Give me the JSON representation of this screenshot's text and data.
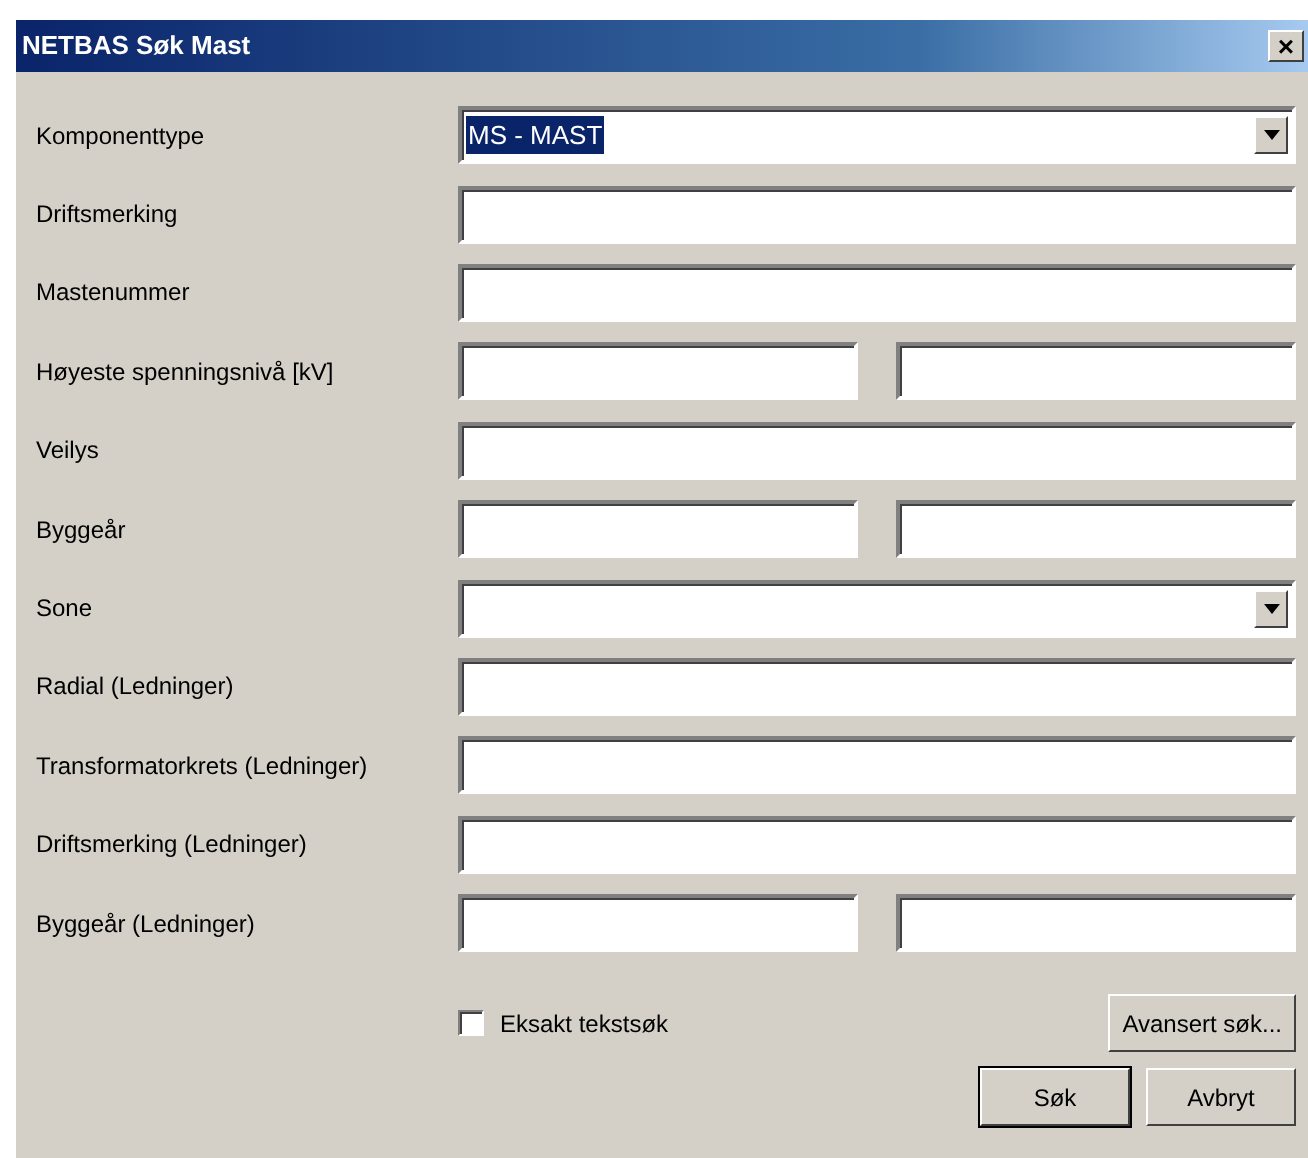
{
  "window": {
    "title": "NETBAS Søk Mast",
    "close": "×"
  },
  "fields": [
    {
      "label": "Komponenttype",
      "kind": "combo",
      "value": "MS - MAST",
      "selected": true
    },
    {
      "label": "Driftsmerking",
      "kind": "text"
    },
    {
      "label": "Mastenummer",
      "kind": "text"
    },
    {
      "label": "Høyeste spenningsnivå [kV]",
      "kind": "range"
    },
    {
      "label": "Veilys",
      "kind": "text"
    },
    {
      "label": "Byggeår",
      "kind": "range"
    },
    {
      "label": "Sone",
      "kind": "combo"
    },
    {
      "label": "Radial (Ledninger)",
      "kind": "text"
    },
    {
      "label": "Transformatorkrets (Ledninger)",
      "kind": "text"
    },
    {
      "label": "Driftsmerking (Ledninger)",
      "kind": "text"
    },
    {
      "label": "Byggeår (Ledninger)",
      "kind": "range"
    }
  ],
  "exact_search": {
    "label": "Eksakt tekstsøk",
    "checked": false
  },
  "advanced_button": "Avansert søk...",
  "buttons": [
    {
      "label": "Søk",
      "default": true
    },
    {
      "label": "Avbryt",
      "default": false
    }
  ]
}
